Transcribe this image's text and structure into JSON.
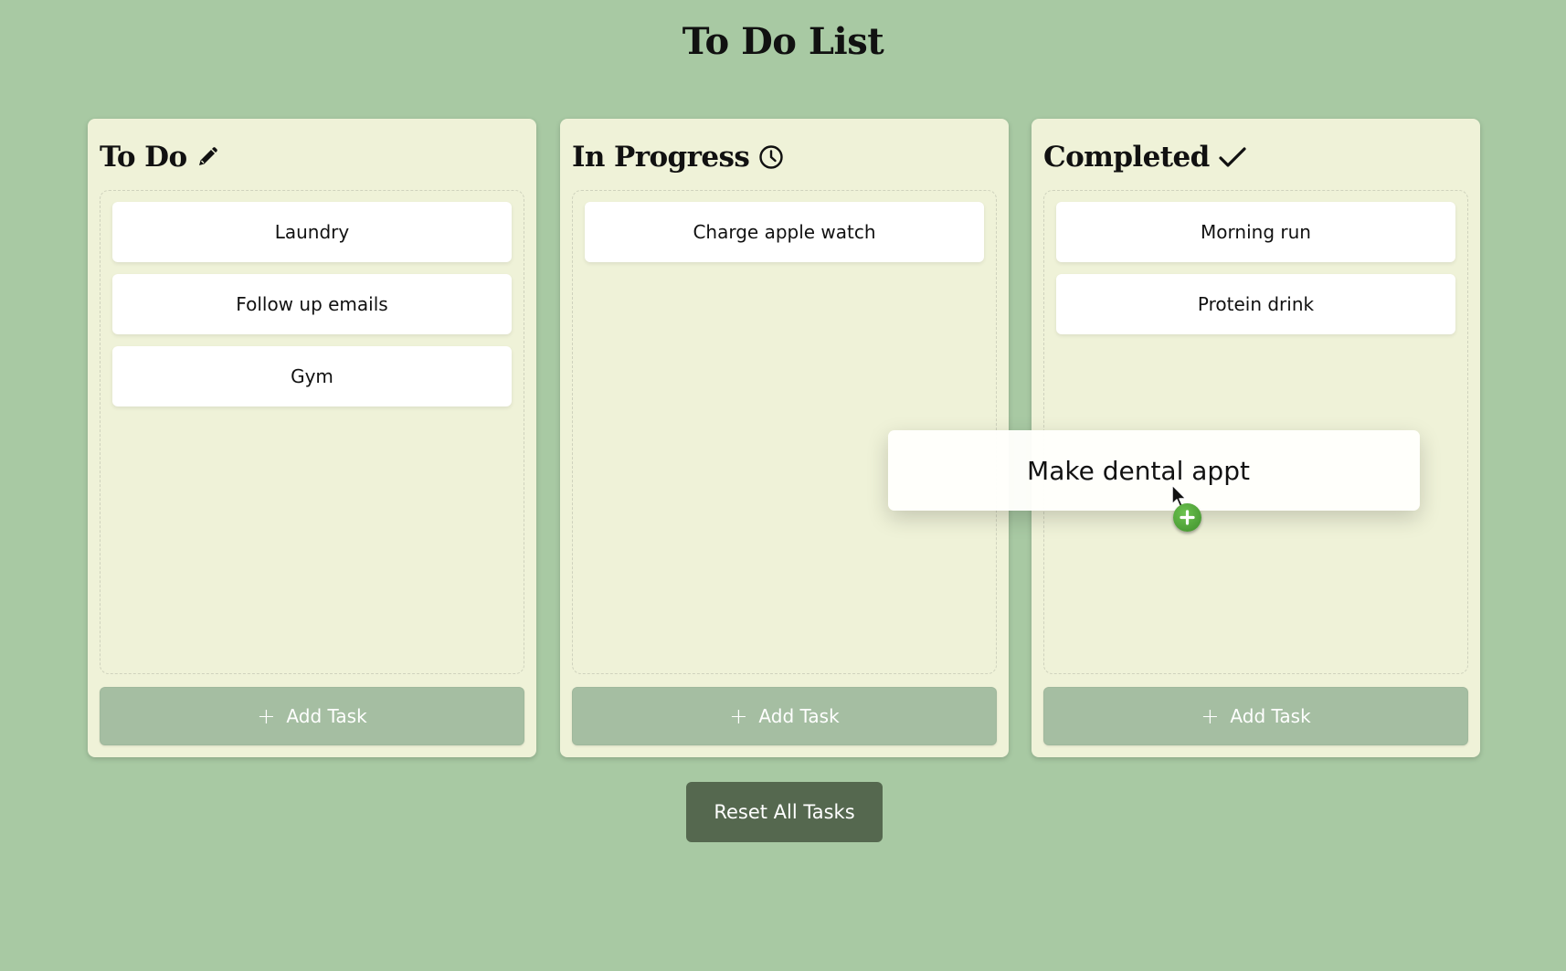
{
  "page": {
    "title": "To Do List"
  },
  "columns": [
    {
      "title": "To Do",
      "icon": "pencil-icon",
      "tasks": [
        "Laundry",
        "Follow up emails",
        "Gym"
      ],
      "add_label": "Add Task"
    },
    {
      "title": "In Progress",
      "icon": "clock-icon",
      "tasks": [
        "Charge apple watch"
      ],
      "add_label": "Add Task"
    },
    {
      "title": "Completed",
      "icon": "check-icon",
      "tasks": [
        "Morning run",
        "Protein drink"
      ],
      "add_label": "Add Task"
    }
  ],
  "drag": {
    "task": "Make dental appt",
    "cursor": "copy-cursor",
    "badge": "plus-icon"
  },
  "reset_label": "Reset All Tasks",
  "colors": {
    "background": "#a8c9a3",
    "column": "#eff2d8",
    "add_button": "#a5bea2",
    "reset_button": "#55684f",
    "copy_badge": "#4a9e36"
  }
}
